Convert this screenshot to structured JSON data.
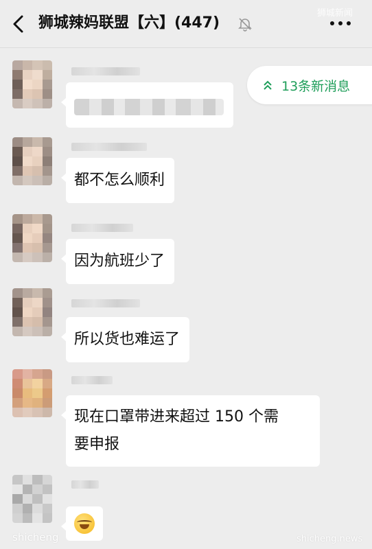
{
  "header": {
    "title": "狮城辣妈联盟【六】(447)",
    "watermark": "狮城新闻"
  },
  "new_messages": {
    "label": "13条新消息"
  },
  "messages": [
    {
      "text": ""
    },
    {
      "text": "都不怎么顺利"
    },
    {
      "text": "因为航班少了"
    },
    {
      "text": "所以货也难运了"
    },
    {
      "text_line1": "现在口罩带进来超过 150 个需",
      "text_line2": "要申报"
    },
    {
      "emoji": "crying-laughing-emoji"
    }
  ],
  "footer": {
    "watermark_left": "shicheng",
    "watermark_right": "shicheng.news"
  },
  "colors": {
    "background": "#ededed",
    "bubble": "#ffffff",
    "accent_green": "#1f9e5a"
  },
  "icons": [
    "back-icon",
    "mute-icon",
    "more-icon",
    "chevron-up-icon"
  ]
}
